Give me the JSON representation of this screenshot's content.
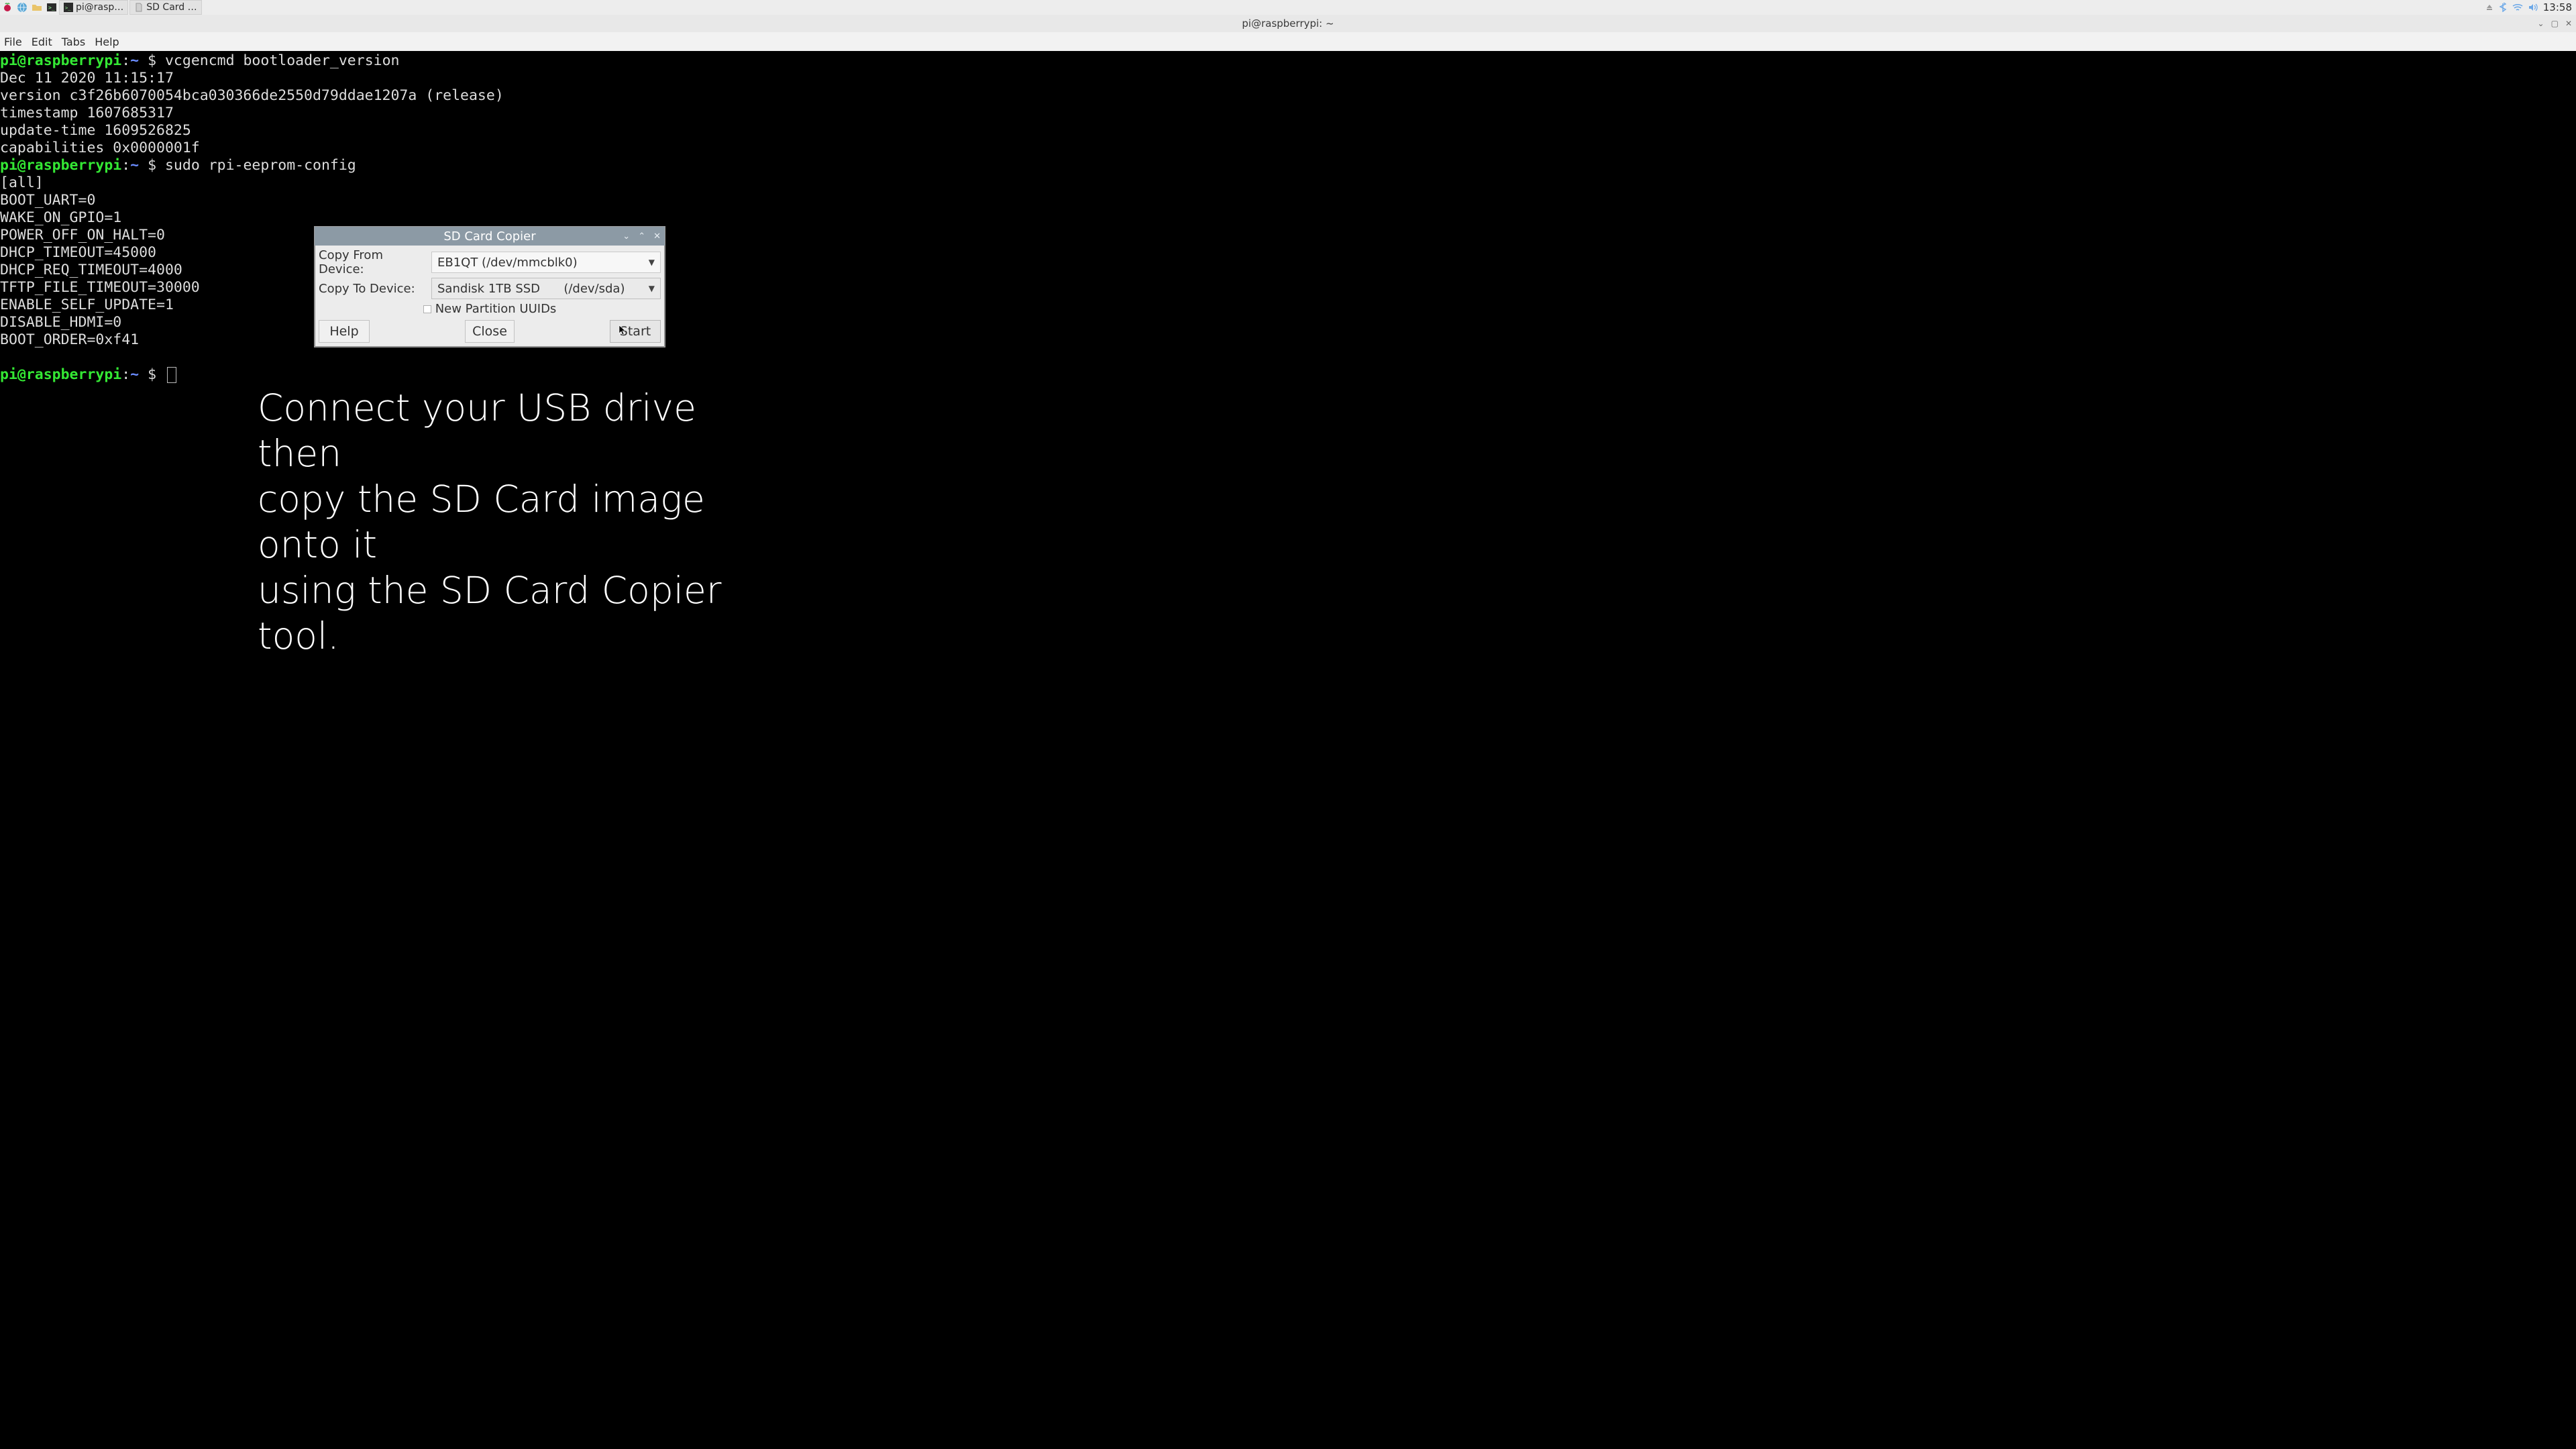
{
  "panel": {
    "taskbuttons": [
      {
        "label": "pi@rasp…"
      },
      {
        "label": "SD Card …"
      }
    ],
    "clock": "13:58"
  },
  "termwin": {
    "title": "pi@raspberrypi: ~",
    "menu": {
      "file": "File",
      "edit": "Edit",
      "tabs": "Tabs",
      "help": "Help"
    },
    "prompt_user": "pi@raspberrypi",
    "prompt_path": "~",
    "prompt_symbol": "$",
    "cmd1": "vcgencmd bootloader_version",
    "out1_l1": "Dec 11 2020 11:15:17",
    "out1_l2": "version c3f26b6070054bca030366de2550d79ddae1207a (release)",
    "out1_l3": "timestamp 1607685317",
    "out1_l4": "update-time 1609526825",
    "out1_l5": "capabilities 0x0000001f",
    "cmd2": "sudo rpi-eeprom-config",
    "out2_l1": "[all]",
    "out2_l2": "BOOT_UART=0",
    "out2_l3": "WAKE_ON_GPIO=1",
    "out2_l4": "POWER_OFF_ON_HALT=0",
    "out2_l5": "DHCP_TIMEOUT=45000",
    "out2_l6": "DHCP_REQ_TIMEOUT=4000",
    "out2_l7": "TFTP_FILE_TIMEOUT=30000",
    "out2_l8": "ENABLE_SELF_UPDATE=1",
    "out2_l9": "DISABLE_HDMI=0",
    "out2_l10": "BOOT_ORDER=0xf41"
  },
  "dialog": {
    "title": "SD Card Copier",
    "from_label": "Copy From Device:",
    "from_value": "EB1QT  (/dev/mmcblk0)",
    "to_label": "Copy To Device:",
    "to_value_name": "Sandisk 1TB SSD",
    "to_value_dev": "(/dev/sda)",
    "checkbox_label": "New Partition UUIDs",
    "help": "Help",
    "close": "Close",
    "start": "Start"
  },
  "caption": {
    "line1": "Connect your USB drive then",
    "line2": "copy the SD Card image onto it",
    "line3": "using the SD Card Copier tool."
  }
}
